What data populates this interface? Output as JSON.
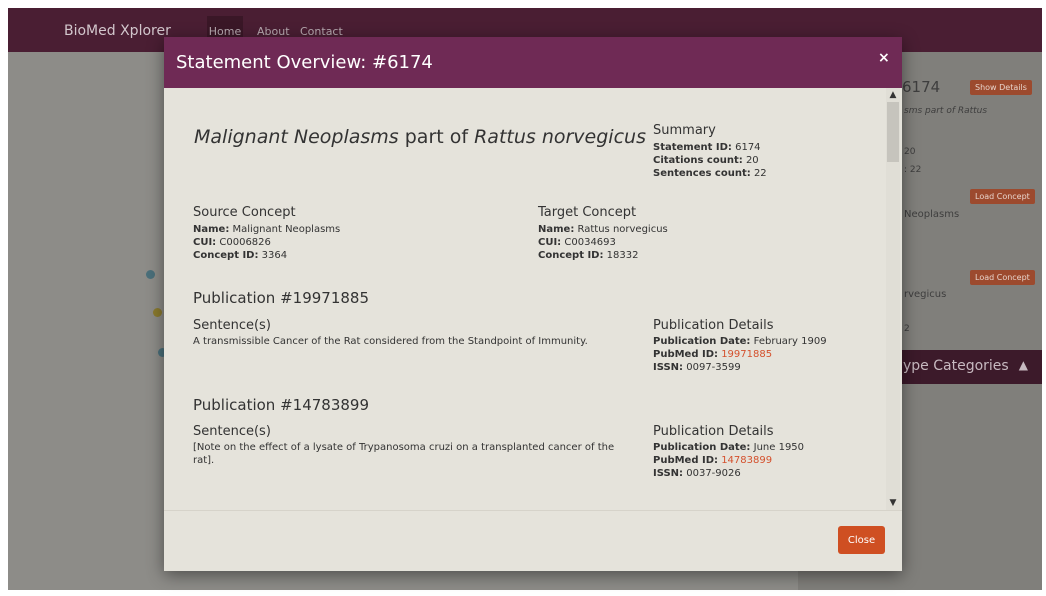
{
  "nav": {
    "brand": "BioMed Xplorer",
    "links": [
      "Home",
      "About",
      "Contact"
    ]
  },
  "background": {
    "title_fragment": "6174",
    "show_details_label": "Show Details",
    "subtitle_fragment": "sms part of Rattus",
    "citations_fragment": "20",
    "sentences_fragment": ": 22",
    "load_concept_label": "Load Concept",
    "source_fragment": "Neoplasms",
    "target_fragment": "rvegicus",
    "id_fragment": "2",
    "types_band": "ype Categories"
  },
  "modal": {
    "title": "Statement Overview: #6174",
    "statement": {
      "subject": "Malignant Neoplasms",
      "predicate": "part of",
      "object": "Rattus norvegicus"
    },
    "summary": {
      "heading": "Summary",
      "statement_id_label": "Statement ID:",
      "statement_id": "6174",
      "citations_label": "Citations count:",
      "citations": "20",
      "sentences_label": "Sentences count:",
      "sentences": "22"
    },
    "source": {
      "heading": "Source Concept",
      "name_label": "Name:",
      "name": "Malignant Neoplasms",
      "cui_label": "CUI:",
      "cui": "C0006826",
      "concept_id_label": "Concept ID:",
      "concept_id": "3364"
    },
    "target": {
      "heading": "Target Concept",
      "name_label": "Name:",
      "name": "Rattus norvegicus",
      "cui_label": "CUI:",
      "cui": "C0034693",
      "concept_id_label": "Concept ID:",
      "concept_id": "18332"
    },
    "publications": [
      {
        "heading": "Publication #19971885",
        "sentences_heading": "Sentence(s)",
        "sentence": "A transmissible Cancer of the Rat considered from the Standpoint of Immunity.",
        "details_heading": "Publication Details",
        "date_label": "Publication Date:",
        "date": "February 1909",
        "pubmed_label": "PubMed ID:",
        "pubmed_id": "19971885",
        "issn_label": "ISSN:",
        "issn": "0097-3599"
      },
      {
        "heading": "Publication #14783899",
        "sentences_heading": "Sentence(s)",
        "sentence": "[Note on the effect of a lysate of Trypanosoma cruzi on a transplanted cancer of the rat].",
        "details_heading": "Publication Details",
        "date_label": "Publication Date:",
        "date": "June 1950",
        "pubmed_label": "PubMed ID:",
        "pubmed_id": "14783899",
        "issn_label": "ISSN:",
        "issn": "0037-9026"
      }
    ],
    "close_button": "Close",
    "close_icon": "×"
  },
  "colors": {
    "modal_header": "#6f2a55",
    "navbar": "#4a1e33",
    "link": "#d4512d",
    "button": "#cf4f22"
  }
}
